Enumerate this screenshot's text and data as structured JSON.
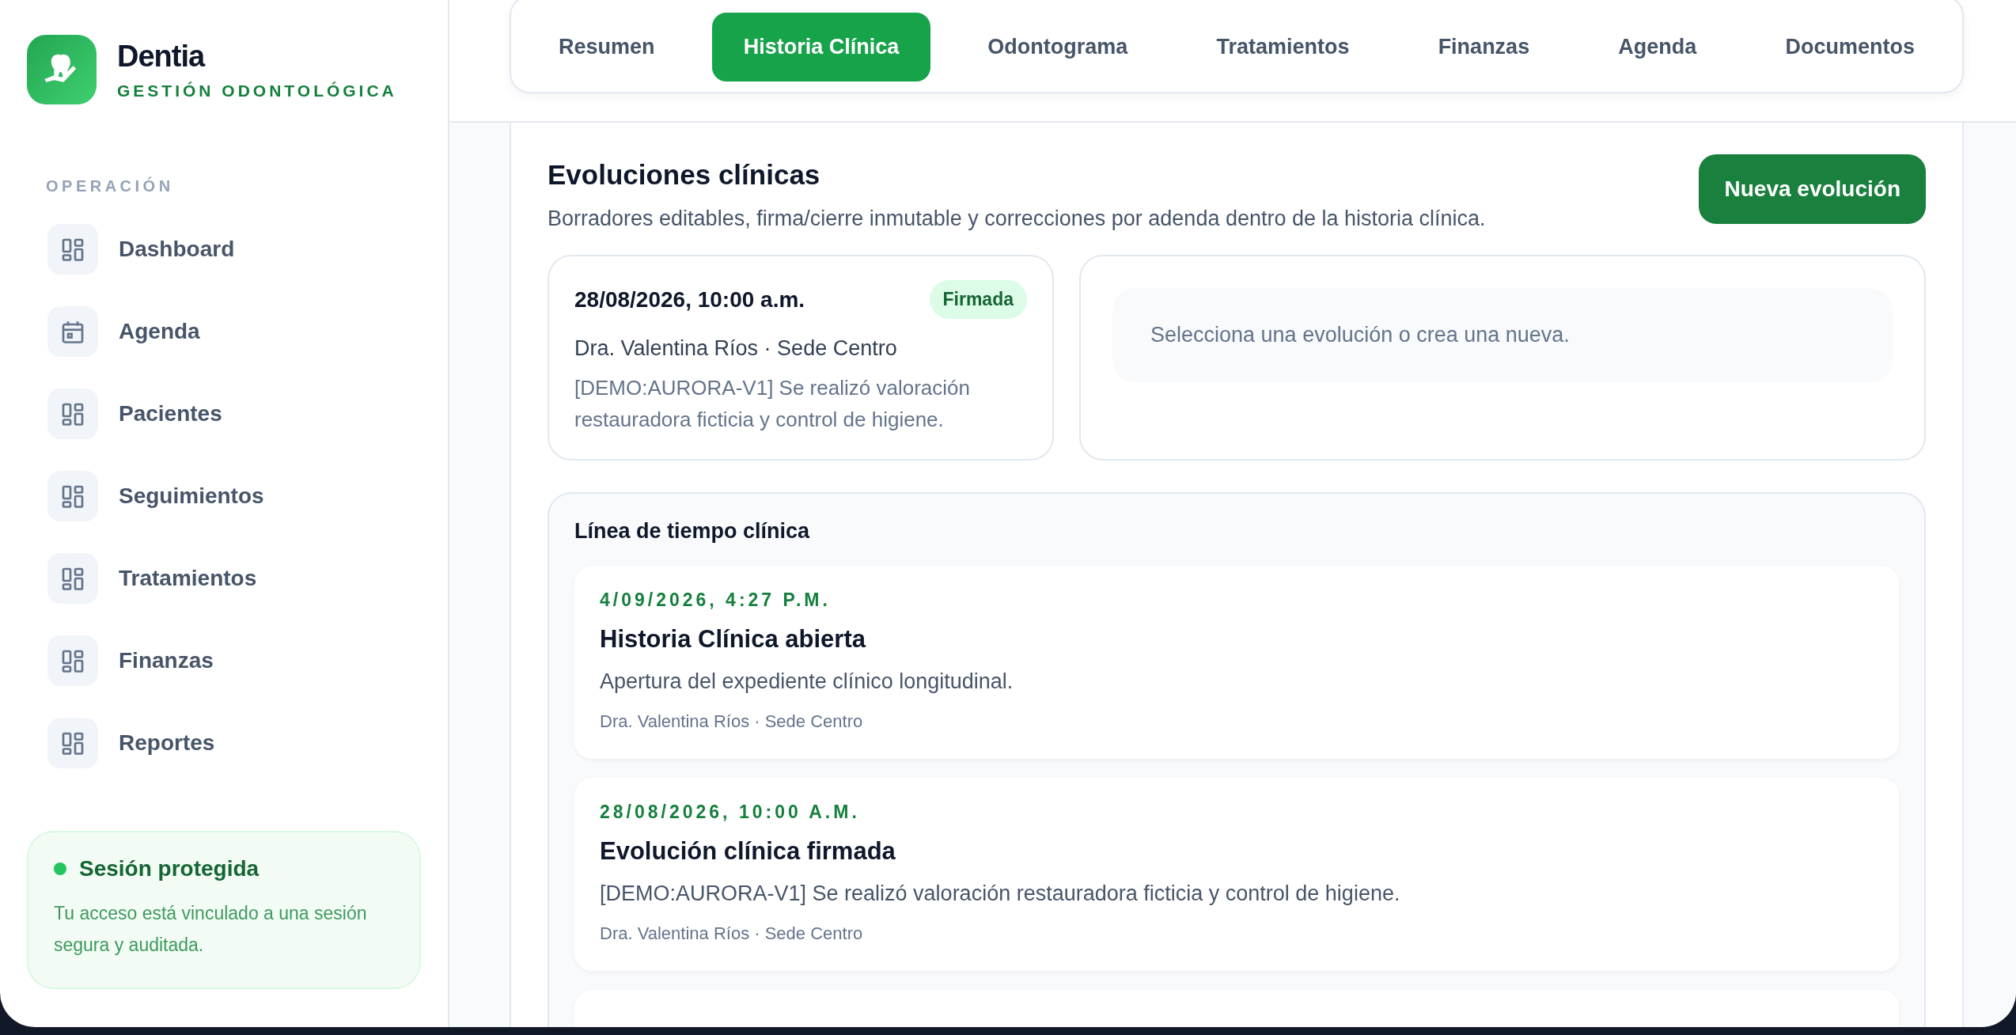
{
  "brand": {
    "name": "Dentia",
    "tagline": "GESTIÓN ODONTOLÓGICA"
  },
  "sidebar": {
    "section": "OPERACIÓN",
    "items": [
      {
        "label": "Dashboard",
        "kind": "grid",
        "selected": false
      },
      {
        "label": "Agenda",
        "kind": "calendar",
        "selected": false
      },
      {
        "label": "Pacientes",
        "kind": "grid",
        "selected": false
      },
      {
        "label": "Seguimientos",
        "kind": "grid",
        "selected": false
      },
      {
        "label": "Tratamientos",
        "kind": "grid",
        "selected": false
      },
      {
        "label": "Finanzas",
        "kind": "grid",
        "selected": false
      },
      {
        "label": "Reportes",
        "kind": "grid",
        "selected": false
      }
    ]
  },
  "session": {
    "title": "Sesión protegida",
    "text": "Tu acceso está vinculado a una sesión segura y auditada."
  },
  "tabs": [
    {
      "label": "Resumen",
      "selected": false
    },
    {
      "label": "Historia Clínica",
      "selected": true
    },
    {
      "label": "Odontograma",
      "selected": false
    },
    {
      "label": "Tratamientos",
      "selected": false
    },
    {
      "label": "Finanzas",
      "selected": false
    },
    {
      "label": "Agenda",
      "selected": false
    },
    {
      "label": "Documentos",
      "selected": false
    }
  ],
  "evolutions": {
    "title": "Evoluciones clínicas",
    "subtitle": "Borradores editables, firma/cierre inmutable y correcciones por adenda dentro de la historia clínica.",
    "new_button": "Nueva evolución",
    "list": [
      {
        "date": "28/08/2026, 10:00 a.m.",
        "status": "Firmada",
        "author": "Dra. Valentina Ríos · Sede Centro",
        "note": "[DEMO:AURORA-V1] Se realizó valoración restauradora ficticia y control de higiene."
      }
    ],
    "detail_placeholder": "Selecciona una evolución o crea una nueva."
  },
  "timeline": {
    "title": "Línea de tiempo clínica",
    "events": [
      {
        "date": "4/09/2026, 4:27 P.M.",
        "title": "Historia Clínica abierta",
        "description": "Apertura del expediente clínico longitudinal.",
        "author": "Dra. Valentina Ríos · Sede Centro"
      },
      {
        "date": "28/08/2026, 10:00 A.M.",
        "title": "Evolución clínica firmada",
        "description": "[DEMO:AURORA-V1] Se realizó valoración restauradora ficticia y control de higiene.",
        "author": "Dra. Valentina Ríos · Sede Centro"
      }
    ]
  }
}
